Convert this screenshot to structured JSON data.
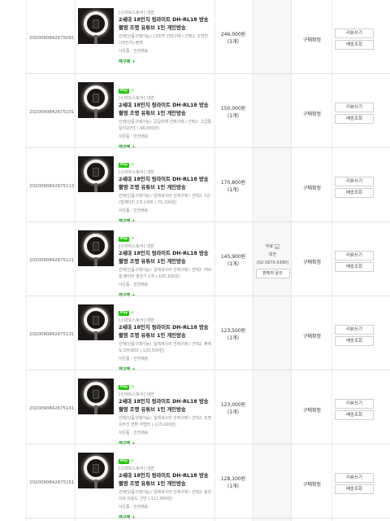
{
  "orders": [
    {
      "order_no": "2020090842675091",
      "seller": "[스마트스토어] 대한",
      "npay": false,
      "title": "2세대 18인치 링라이트 DH-RL18 방송 촬영 조명 유튜브 1인 개인방송",
      "option": "선택(단품구매가능): [3조명 선택구매 / 선택2: 조명만(18인치)-블랙",
      "shipping": "사은품 : 안전배송",
      "rebuy": "재구매 +",
      "price": "246,000원",
      "qty": "(1개)",
      "status": "구매확정",
      "btn_review": "리뷰쓰기",
      "btn_track": "배송조회"
    },
    {
      "order_no": "2020090842675101",
      "seller": "[스마트스토어] 대한",
      "npay": true,
      "title": "2세대 18인치 링라이트 DH-RL18 방송 촬영 조명 유튜브 1인 개인방송",
      "option": "선택(단품구매가능): 공급자재 선택구매 / 선택2: 고급통일리모컨1 (-96,000원)",
      "shipping": "사은품 : 안전배송",
      "rebuy": "재구매 +",
      "price": "150,000원",
      "qty": "(1개)",
      "status": "구매확정",
      "btn_review": "리뷰쓰기",
      "btn_track": "배송조회"
    },
    {
      "order_no": "2020090842675113",
      "seller": "[스마트스토어] 대한",
      "npay": true,
      "title": "2세대 18인치 링라이트 DH-RL18 방송 촬영 조명 유튜브 1인 개인방송",
      "option": "선택(단품구매가능): 일체세사라 선택구매 / 선택2: 1단(밀배터리 2개 1세트 (-75,200원)",
      "shipping": "사은품 : 안전배송",
      "rebuy": "재구매 +",
      "price": "170,800원",
      "qty": "(1개)",
      "status": "구매확정",
      "btn_review": "리뷰쓰기",
      "btn_track": "배송조회"
    },
    {
      "order_no": "2020090842675121",
      "seller": "[스마트스토어] 대한",
      "npay": true,
      "title": "2세대 18인치 링라이트 DH-RL18 방송 촬영 조명 유튜브 1인 개인방송",
      "option": "선택(단품구매가능): 일체세사라 선택구매 / 선택2: F60밀 배터리 충전기 1개 (-100,100원)",
      "shipping": "사은품 : 안전배송",
      "rebuy": "재구매 +",
      "price": "145,900원",
      "qty": "(1개)",
      "status": "구매확정",
      "btn_review": "리뷰쓰기",
      "btn_track": "배송조회"
    },
    {
      "order_no": "2020090842675131",
      "seller": "[스마트스토어] 대한",
      "npay": true,
      "title": "2세대 18인치 링라이트 DH-RL18 방송 촬영 조명 유튜브 1인 개인방송",
      "option": "선택(단품구매가능): 일체세사라 선택구매 / 선택2: 블랙도 DH-B03 (-120,500원)",
      "shipping": "사은품 : 안전배송",
      "rebuy": "재구매 +",
      "price": "123,500원",
      "qty": "(1개)",
      "status": "구매확정",
      "btn_review": "리뷰쓰기",
      "btn_track": "배송조회"
    },
    {
      "order_no": "2020090842675141",
      "seller": "[스마트스토어] 대한",
      "npay": true,
      "title": "2세대 18인치 링라이트 DH-RL18 방송 촬영 조명 유튜브 1인 개인방송",
      "option": "선택(단품구매가능): 일체세사라 선택구매 / 선택2: 조명 유무선 변환 어댑터 (-123,000원)",
      "shipping": "사은품 : 안전배송",
      "rebuy": "재구매 +",
      "price": "123,000원",
      "qty": "(1개)",
      "status": "구매확정",
      "btn_review": "리뷰쓰기",
      "btn_track": "배송조회"
    },
    {
      "order_no": "2020090842675151",
      "seller": "[스마트스토어] 대한",
      "npay": true,
      "title": "2세대 18인치 링라이트 DH-RL18 방송 촬영 조명 유튜브 1인 개인방송",
      "option": "선택(단품구매가능): 일체세사라 선택구매 / 선택2: 링라이트 다용도 선반 (-117,900원)",
      "shipping": "사은품 : 안전배송",
      "rebuy": "재구매 +",
      "price": "128,100원",
      "qty": "(1개)",
      "status": "구매확정",
      "btn_review": "리뷰쓰기",
      "btn_track": "배송조회"
    }
  ],
  "npay_label": "Pay",
  "shipping_panel": {
    "fee": "무료",
    "arrow": "▸",
    "seller": "대한",
    "phone": "(02-1670-5390)",
    "inquiry_button": "판매자 문의"
  },
  "colors": {
    "npay_green": "#1ec800",
    "rebuy_green": "#1a9b1a",
    "delivery_col_bg": "#f7f7f7"
  }
}
